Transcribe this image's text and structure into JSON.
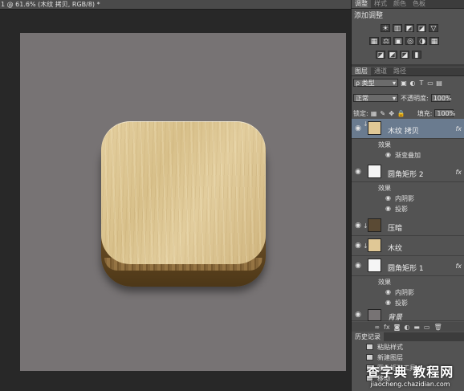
{
  "document": {
    "tab_title": "1 @ 61.6% (木纹 拷贝, RGB/8) *"
  },
  "panels": {
    "top_tabs": [
      "调整",
      "样式",
      "颜色",
      "色板"
    ],
    "adjustments": {
      "title": "添加调整",
      "row1": [
        "☀",
        "▥",
        "◩",
        "◪",
        "▽"
      ],
      "row2": [
        "▦",
        "⚖",
        "▣",
        "◎",
        "◑",
        "▦"
      ],
      "row3": [
        "◪",
        "◩",
        "◪",
        "▮"
      ]
    },
    "layers_tabs": [
      "图层",
      "通道",
      "路径"
    ]
  },
  "layers_panel": {
    "filter_label": "ρ 类型",
    "filter_icons": [
      "▣",
      "◐",
      "T",
      "▭",
      "▤"
    ],
    "blend_mode": "正常",
    "opacity_label": "不透明度:",
    "opacity_value": "100%",
    "lock_label": "锁定:",
    "lock_icons": [
      "▦",
      "✎",
      "✥",
      "🔒"
    ],
    "fill_label": "填充:",
    "fill_value": "100%",
    "layers": [
      {
        "name": "木纹 拷贝",
        "fx": "fx",
        "selected": true,
        "effects_label": "效果",
        "effects": [
          "渐变叠加"
        ]
      },
      {
        "name": "圆角矩形 2",
        "fx": "fx",
        "effects_label": "效果",
        "effects": [
          "内阴影",
          "投影"
        ]
      },
      {
        "name": "压暗"
      },
      {
        "name": "木纹"
      },
      {
        "name": "圆角矩形 1",
        "fx": "fx",
        "effects_label": "效果",
        "effects": [
          "内阴影",
          "投影"
        ]
      },
      {
        "name": "背景"
      }
    ],
    "footer_icons": [
      "∞",
      "fx",
      "◙",
      "◐",
      "▬",
      "▭",
      "🗑"
    ]
  },
  "history": {
    "tab": "历史记录",
    "items": [
      "粘贴样式",
      "新建图层",
      "圆角矩形工具",
      "移动"
    ]
  },
  "watermark": {
    "main": "查字典 教程网",
    "sub": "jiaocheng.chazidian.com"
  },
  "colors": {
    "canvas": "#777374",
    "panel": "#535353",
    "selected_layer": "#6a7b8f"
  }
}
